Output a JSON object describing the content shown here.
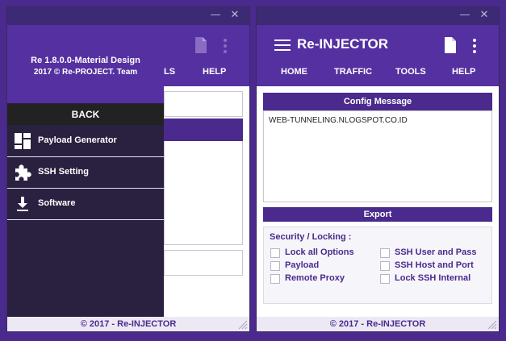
{
  "left_window": {
    "tabs": [
      "LS",
      "HELP"
    ],
    "drawer": {
      "version": "Re 1.8.0.0-Material Design",
      "copyright": "2017 © Re-PROJECT. Team",
      "back_label": "BACK",
      "items": [
        {
          "label": "Payload Generator",
          "icon": "payload-generator-icon"
        },
        {
          "label": "SSH Setting",
          "icon": "puzzle-icon"
        },
        {
          "label": "Software",
          "icon": "download-icon"
        }
      ]
    },
    "footer": "© 2017 - Re-INJECTOR"
  },
  "right_window": {
    "title": "Re-INJECTOR",
    "tabs": [
      "HOME",
      "TRAFFIC",
      "TOOLS",
      "HELP"
    ],
    "config_header": "Config Message",
    "config_text": "WEB-TUNNELING.NLOGSPOT.CO.ID",
    "export_header": "Export",
    "security": {
      "title": "Security / Locking :",
      "options_left": [
        "Lock all Options",
        "Payload",
        "Remote Proxy"
      ],
      "options_right": [
        "SSH User and Pass",
        "SSH Host and Port",
        "Lock SSH Internal"
      ]
    },
    "footer": "© 2017 - Re-INJECTOR"
  },
  "window_controls": {
    "minimize": "—",
    "close": "✕"
  },
  "colors": {
    "primary": "#5530a0",
    "dark": "#2a2040",
    "back": "#222222",
    "text_accent": "#4a2a8c"
  }
}
